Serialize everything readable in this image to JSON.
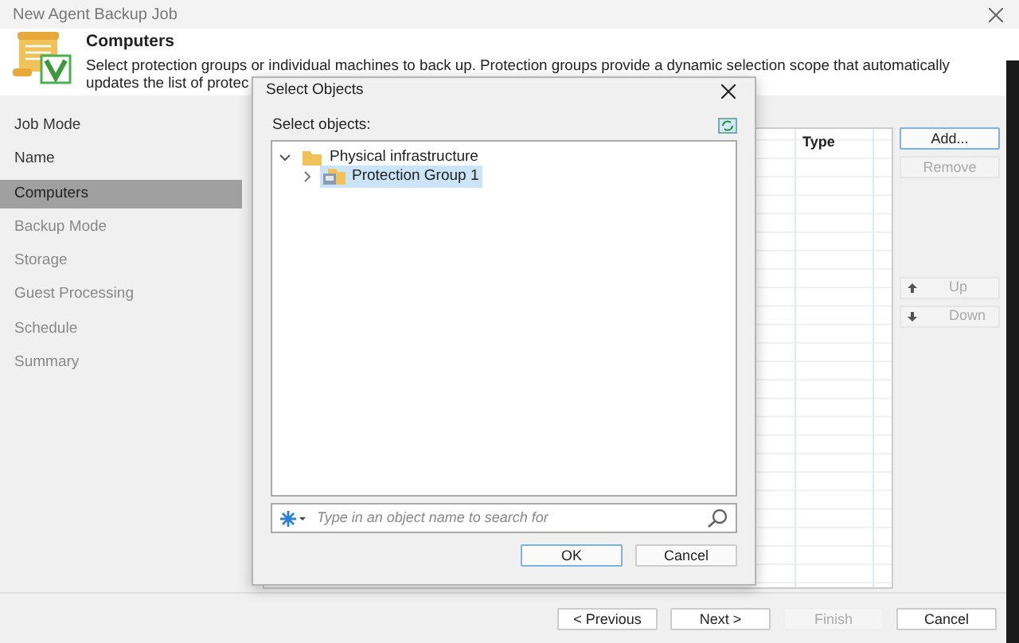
{
  "window": {
    "title": "New Agent Backup Job"
  },
  "header": {
    "title": "Computers",
    "description_lines": [
      "Select protection groups or individual machines to back up. Protection groups provide a dynamic selection scope that automatically",
      "updates the list of protec"
    ]
  },
  "steps": [
    {
      "label": "Job Mode",
      "selected": false,
      "disabled": false
    },
    {
      "label": "Name",
      "selected": false,
      "disabled": false
    },
    {
      "label": "Computers",
      "selected": true,
      "disabled": false
    },
    {
      "label": "Backup Mode",
      "selected": false,
      "disabled": true
    },
    {
      "label": "Storage",
      "selected": false,
      "disabled": true
    },
    {
      "label": "Guest Processing",
      "selected": false,
      "disabled": true
    },
    {
      "label": "Schedule",
      "selected": false,
      "disabled": true
    },
    {
      "label": "Summary",
      "selected": false,
      "disabled": true
    }
  ],
  "table": {
    "columns": [
      "Type"
    ]
  },
  "side_buttons": [
    {
      "label": "Add...",
      "disabled": false,
      "kind": "plain"
    },
    {
      "label": "Remove",
      "disabled": true,
      "kind": "plain"
    },
    {
      "label": "Up",
      "disabled": true,
      "kind": "up"
    },
    {
      "label": "Down",
      "disabled": true,
      "kind": "down"
    }
  ],
  "footer_buttons": [
    {
      "label": "< Previous",
      "disabled": false
    },
    {
      "label": "Next >",
      "disabled": false
    },
    {
      "label": "Finish",
      "disabled": true
    },
    {
      "label": "Cancel",
      "disabled": false
    }
  ],
  "dialog": {
    "title": "Select Objects",
    "label": "Select objects:",
    "tree": [
      {
        "label": "Physical infrastructure",
        "expanded": true,
        "selected": false,
        "kind": "folder",
        "children": [
          {
            "label": "Protection Group 1",
            "expanded": false,
            "selected": true,
            "kind": "group"
          }
        ]
      }
    ],
    "search": {
      "placeholder": "Type in an object name to search for"
    },
    "buttons": [
      {
        "label": "OK",
        "default": true
      },
      {
        "label": "Cancel",
        "default": false
      }
    ]
  }
}
